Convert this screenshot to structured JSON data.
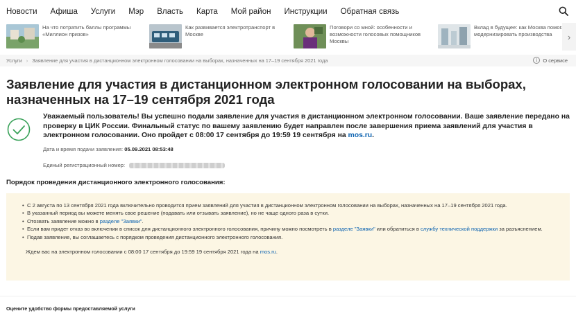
{
  "nav": {
    "items": [
      "Новости",
      "Афиша",
      "Услуги",
      "Мэр",
      "Власть",
      "Карта",
      "Мой район",
      "Инструкции",
      "Обратная связь"
    ]
  },
  "news": [
    {
      "text": "На что потратить баллы программы «Миллион призов»"
    },
    {
      "text": "Как развивается электротранспорт в Москве"
    },
    {
      "text": "Поговори со мной: особенности и возможности голосовых помощников Москвы"
    },
    {
      "text": "Вклад в будущее: как Москва помогает модернизировать производства"
    }
  ],
  "breadcrumb": {
    "root": "Услуги",
    "current": "Заявление для участия в дистанционном электронном голосовании на выборах, назначенных на 17–19 сентября 2021 года",
    "about": "О сервисе"
  },
  "title": "Заявление для участия в дистанционном электронном голосовании на выборах, назначенных на 17–19 сентября 2021 года",
  "success": {
    "message": "Уважаемый пользователь! Вы успешно подали заявление для участия в дистанционном электронном голосовании. Ваше заявление передано на проверку в ЦИК России. Финальный статус по вашему заявлению будет направлен после завершения приема заявлений для участия в электронном голосовании. Оно пройдет с 08:00 17 сентября до 19:59 19 сентября на ",
    "link": "mos.ru",
    "end": "."
  },
  "meta": {
    "date_label": "Дата и время подачи заявления: ",
    "date_value": "05.09.2021 08:53:48",
    "reg_label": "Единый регистрационный номер:"
  },
  "procedure": {
    "title": "Порядок проведения дистанционного электронного голосования:",
    "item1": "С 2 августа по 13 сентября 2021 года включительно проводится прием заявлений для участия в дистанционном электронном голосовании на выборах, назначенных на 17–19 сентября 2021 года.",
    "item2": "В указанный период вы можете менять свое решение (подавать или отзывать заявление), но не чаще одного раза в сутки.",
    "item3_a": "Отозвать заявление можно в ",
    "item3_link": "разделе \"Заявки\"",
    "item3_b": ".",
    "item4_a": "Если вам придет отказ во включении в список для дистанционного электронного голосования, причину можно посмотреть в ",
    "item4_link1": "разделе \"Заявки\"",
    "item4_b": " или обратиться в ",
    "item4_link2": "службу технической поддержки",
    "item4_c": " за разъяснением.",
    "item5": "Подав заявление, вы соглашаетесь с порядком проведения дистанционного электронного голосования.",
    "final_a": "Ждем вас на электронном голосовании с 08:00 17 сентября до 19:59 19 сентября 2021 года на ",
    "final_link": "mos.ru",
    "final_b": "."
  },
  "footer": {
    "rate_label": "Оцените удобство формы предоставляемой услуги"
  },
  "colors": {
    "accent_link": "#0b62b0",
    "success_green": "#3aa25a",
    "notice_bg": "#fcf6e4"
  }
}
